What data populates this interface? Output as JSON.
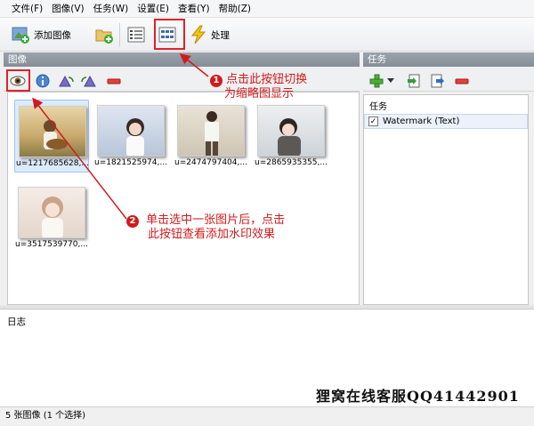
{
  "menu": [
    "文件(F)",
    "图像(V)",
    "任务(W)",
    "设置(E)",
    "查看(Y)",
    "帮助(Z)"
  ],
  "toolbar": {
    "add_image_label": "添加图像",
    "process_label": "处理"
  },
  "image_panel": {
    "title": "图像"
  },
  "task_panel": {
    "title": "任务",
    "list_header": "任务",
    "task_item": "Watermark (Text)",
    "task_checked": true
  },
  "thumbnails": [
    {
      "caption": "u=1217685628,...",
      "selected": true
    },
    {
      "caption": "u=1821525974,...",
      "selected": false
    },
    {
      "caption": "u=2474797404,...",
      "selected": false
    },
    {
      "caption": "u=2865935355,...",
      "selected": false
    },
    {
      "caption": "u=3517539770,...",
      "selected": false
    }
  ],
  "annotations": {
    "one_line1": "点击此按钮切换",
    "one_line2": "为缩略图显示",
    "two_line1": "单击选中一张图片后，点击",
    "two_line2": "此按钮查看添加水印效果",
    "one_num": "1",
    "two_num": "2"
  },
  "log": {
    "title": "日志"
  },
  "watermark_text": "狸窝在线客服QQ41442901",
  "status": "5 张图像 (1 个选择)",
  "colors": {
    "annotation_red": "#d11b1b",
    "panel_header": "#8f97a1",
    "selection": "#dcebfb"
  }
}
